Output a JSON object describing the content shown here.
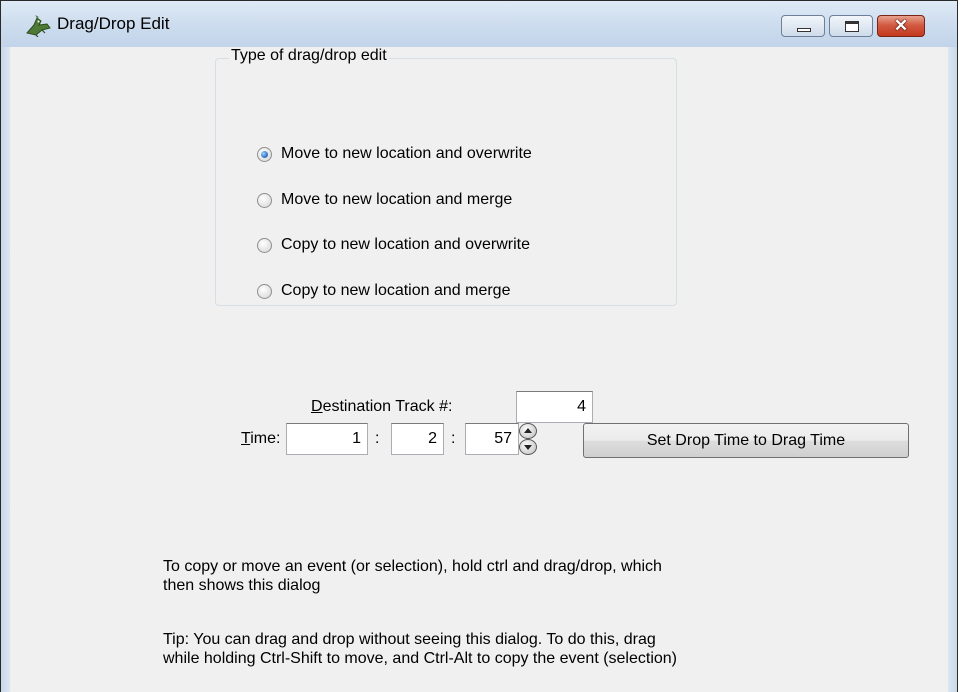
{
  "window": {
    "title": "Drag/Drop Edit",
    "controls": {
      "minimize": "",
      "maximize": "",
      "close": "✕"
    }
  },
  "group": {
    "legend": "Type of drag/drop edit",
    "options": [
      {
        "label": "Move to new location and overwrite",
        "checked": true
      },
      {
        "label": "Move to new location and merge",
        "checked": false
      },
      {
        "label": "Copy to new location and overwrite",
        "checked": false
      },
      {
        "label": "Copy to new location and merge",
        "checked": false
      }
    ]
  },
  "destination": {
    "label": "Destination Track #:",
    "value": "4"
  },
  "time": {
    "label": "Time:",
    "separator": ":",
    "hours": "1",
    "minutes": "2",
    "ticks": "57"
  },
  "set_button": {
    "label": "Set Drop Time to Drag Time"
  },
  "help": {
    "line1": "To copy or move an event (or selection), hold ctrl and drag/drop, which",
    "line2": "then shows this dialog",
    "tip1": "Tip: You can drag and drop without seeing this dialog. To do this, drag",
    "tip2": "while holding Ctrl-Shift to move, and Ctrl-Alt to copy the event (selection)"
  },
  "colors": {
    "accent": "#1a64b7",
    "close": "#c2381e"
  },
  "icons": {
    "app": "alligator-icon"
  }
}
